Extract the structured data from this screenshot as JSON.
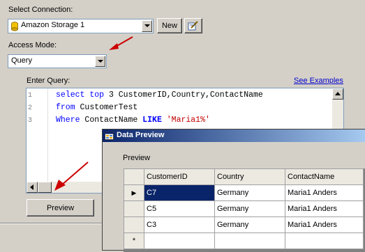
{
  "connection": {
    "label": "Select Connection:",
    "selected": "Amazon Storage 1",
    "new_button": "New"
  },
  "access_mode": {
    "label": "Access Mode:",
    "selected": "Query"
  },
  "query": {
    "label": "Enter Query:",
    "link": "See Examples",
    "line_numbers": [
      "1",
      "2",
      "3"
    ],
    "lines": [
      [
        "select",
        "top",
        "3",
        "CustomerID,Country,ContactName"
      ],
      [
        "from",
        "CustomerTest"
      ],
      [
        "Where",
        "ContactName",
        "LIKE",
        "'Maria1%'"
      ]
    ]
  },
  "preview_button": "Preview",
  "data_preview": {
    "title": "Data Preview",
    "group_label": "Preview",
    "columns": [
      "CustomerID",
      "Country",
      "ContactName"
    ],
    "rows": [
      [
        "C7",
        "Germany",
        "Maria1 Anders"
      ],
      [
        "C5",
        "Germany",
        "Maria1 Anders"
      ],
      [
        "C3",
        "Germany",
        "Maria1 Anders"
      ]
    ],
    "current_row_marker": "▶",
    "new_row_marker": "*"
  },
  "colors": {
    "selection": "#0a246a",
    "arrow": "#cc0000"
  }
}
